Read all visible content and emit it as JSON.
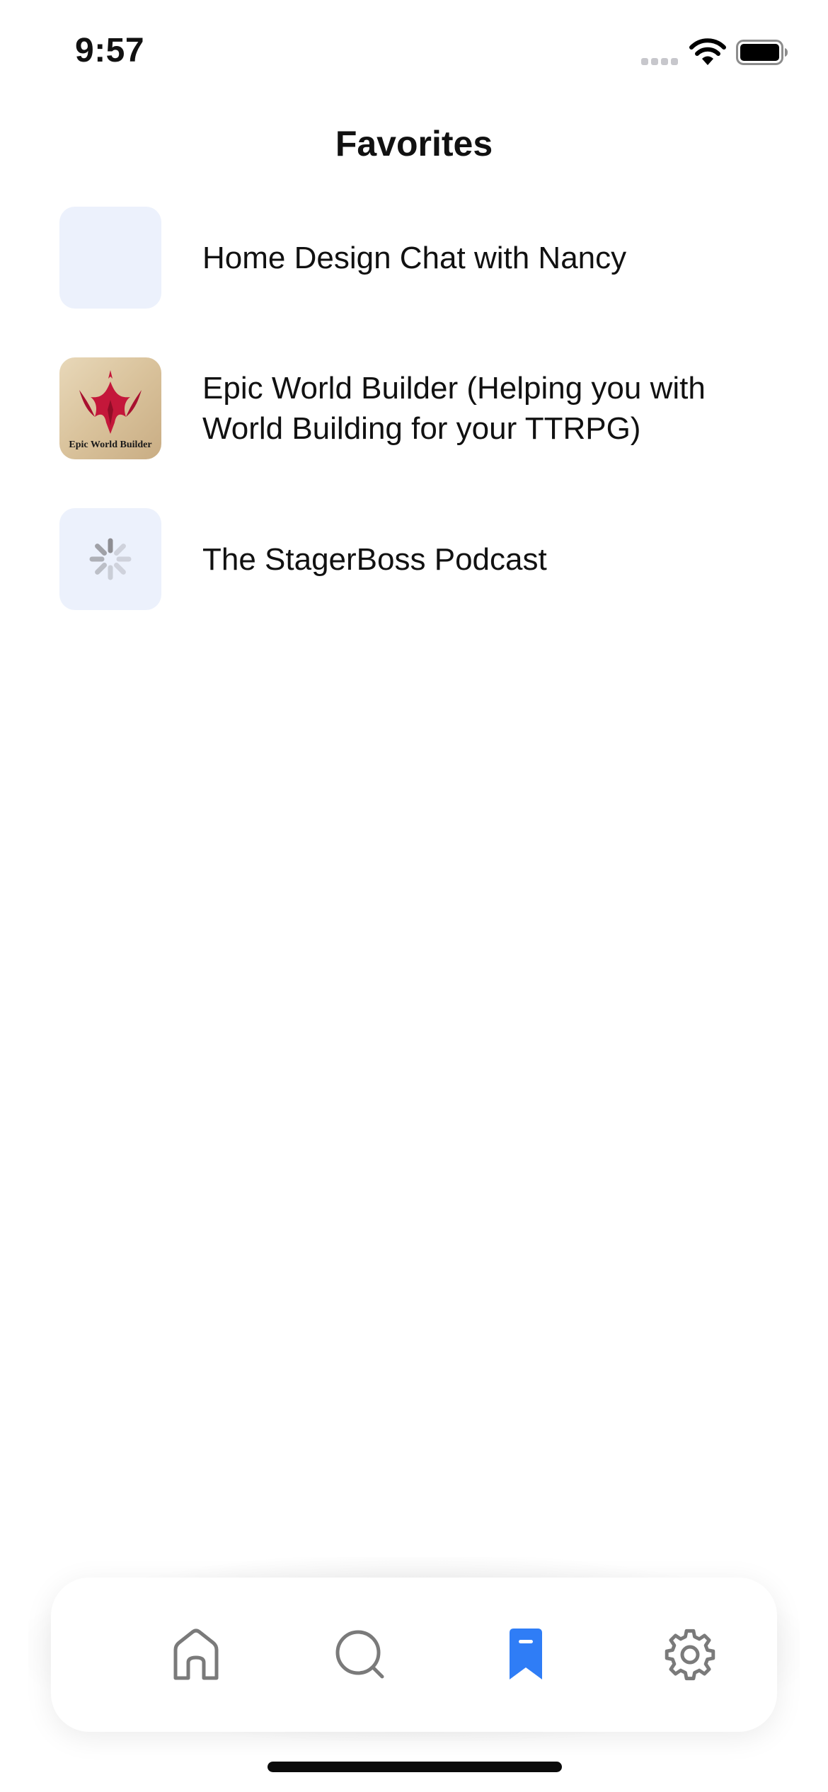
{
  "status_bar": {
    "time": "9:57"
  },
  "header": {
    "title": "Favorites"
  },
  "favorites": [
    {
      "title": "Home Design Chat with Nancy",
      "thumbnail": "placeholder"
    },
    {
      "title": "Epic World Builder (Helping you with World Building for your TTRPG)",
      "thumbnail": "artwork",
      "artwork_caption": "Epic World Builder"
    },
    {
      "title": "The StagerBoss Podcast",
      "thumbnail": "loading-spinner-icon"
    }
  ],
  "tab_bar": {
    "tabs": [
      {
        "icon": "home-icon",
        "active": false
      },
      {
        "icon": "search-icon",
        "active": false
      },
      {
        "icon": "bookmark-icon",
        "active": true
      },
      {
        "icon": "gear-icon",
        "active": false
      }
    ]
  },
  "colors": {
    "accent": "#2f7df6",
    "inactive_icon": "#7a7a7a",
    "thumbnail_placeholder": "#ecf1fc",
    "artwork_red": "#c4173a"
  }
}
